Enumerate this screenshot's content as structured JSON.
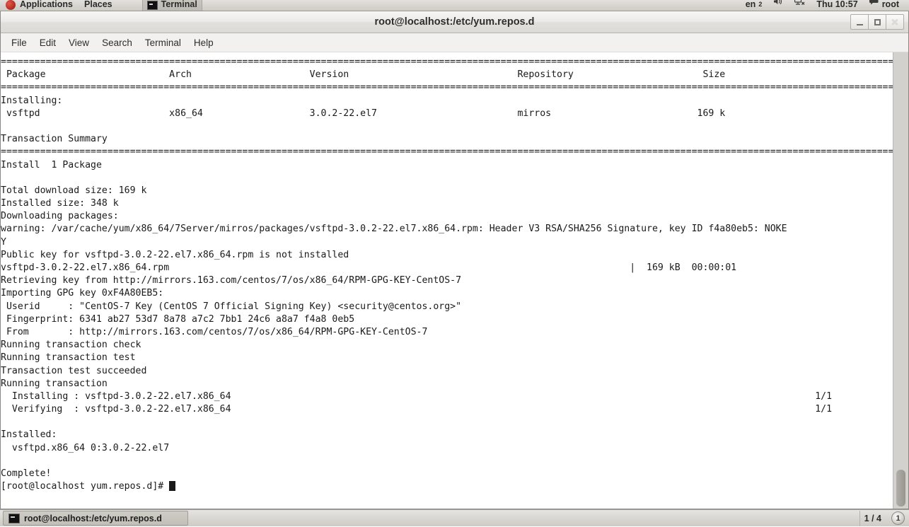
{
  "top_panel": {
    "applications_label": "Applications",
    "places_label": "Places",
    "window_tab_label": "Terminal",
    "keyboard_layout": "en",
    "keyboard_layout_index": "2",
    "volume_icon": "speaker-icon",
    "network_icon": "network-disconnected-icon",
    "clock": "Thu 10:57",
    "user_icon": "user-session-icon",
    "user_label": "root",
    "logo_icon": "centos-logo-icon"
  },
  "window": {
    "title": "root@localhost:/etc/yum.repos.d",
    "minimize_label": "Minimize",
    "maximize_label": "Maximize",
    "close_label": "Close",
    "close_glyph": "✕"
  },
  "menu": {
    "items": [
      {
        "label": "File"
      },
      {
        "label": "Edit"
      },
      {
        "label": "View"
      },
      {
        "label": "Search"
      },
      {
        "label": "Terminal"
      },
      {
        "label": "Help"
      }
    ]
  },
  "terminal": {
    "prompt": "[root@localhost yum.repos.d]# ",
    "lines": [
      "================================================================================================================================================================",
      " Package                      Arch                     Version                              Repository                       Size",
      "================================================================================================================================================================",
      "Installing:",
      " vsftpd                       x86_64                   3.0.2-22.el7                         mirros                          169 k",
      "",
      "Transaction Summary",
      "================================================================================================================================================================",
      "Install  1 Package",
      "",
      "Total download size: 169 k",
      "Installed size: 348 k",
      "Downloading packages:",
      "warning: /var/cache/yum/x86_64/7Server/mirros/packages/vsftpd-3.0.2-22.el7.x86_64.rpm: Header V3 RSA/SHA256 Signature, key ID f4a80eb5: NOKE",
      "Y",
      "Public key for vsftpd-3.0.2-22.el7.x86_64.rpm is not installed",
      "vsftpd-3.0.2-22.el7.x86_64.rpm                                                                                  |  169 kB  00:00:01",
      "Retrieving key from http://mirrors.163.com/centos/7/os/x86_64/RPM-GPG-KEY-CentOS-7",
      "Importing GPG key 0xF4A80EB5:",
      " Userid     : \"CentOS-7 Key (CentOS 7 Official Signing Key) <security@centos.org>\"",
      " Fingerprint: 6341 ab27 53d7 8a78 a7c2 7bb1 24c6 a8a7 f4a8 0eb5",
      " From       : http://mirrors.163.com/centos/7/os/x86_64/RPM-GPG-KEY-CentOS-7",
      "Running transaction check",
      "Running transaction test",
      "Transaction test succeeded",
      "Running transaction",
      "  Installing : vsftpd-3.0.2-22.el7.x86_64                                                                                                        1/1",
      "  Verifying  : vsftpd-3.0.2-22.el7.x86_64                                                                                                        1/1",
      "",
      "Installed:",
      "  vsftpd.x86_64 0:3.0.2-22.el7",
      "",
      "Complete!"
    ],
    "scrollbar": "vertical-scrollbar"
  },
  "taskbar": {
    "task_label": "root@localhost:/etc/yum.repos.d",
    "task_icon": "terminal-icon",
    "workspace_indicator": "1 / 4",
    "workspace_circle_label": "1"
  }
}
